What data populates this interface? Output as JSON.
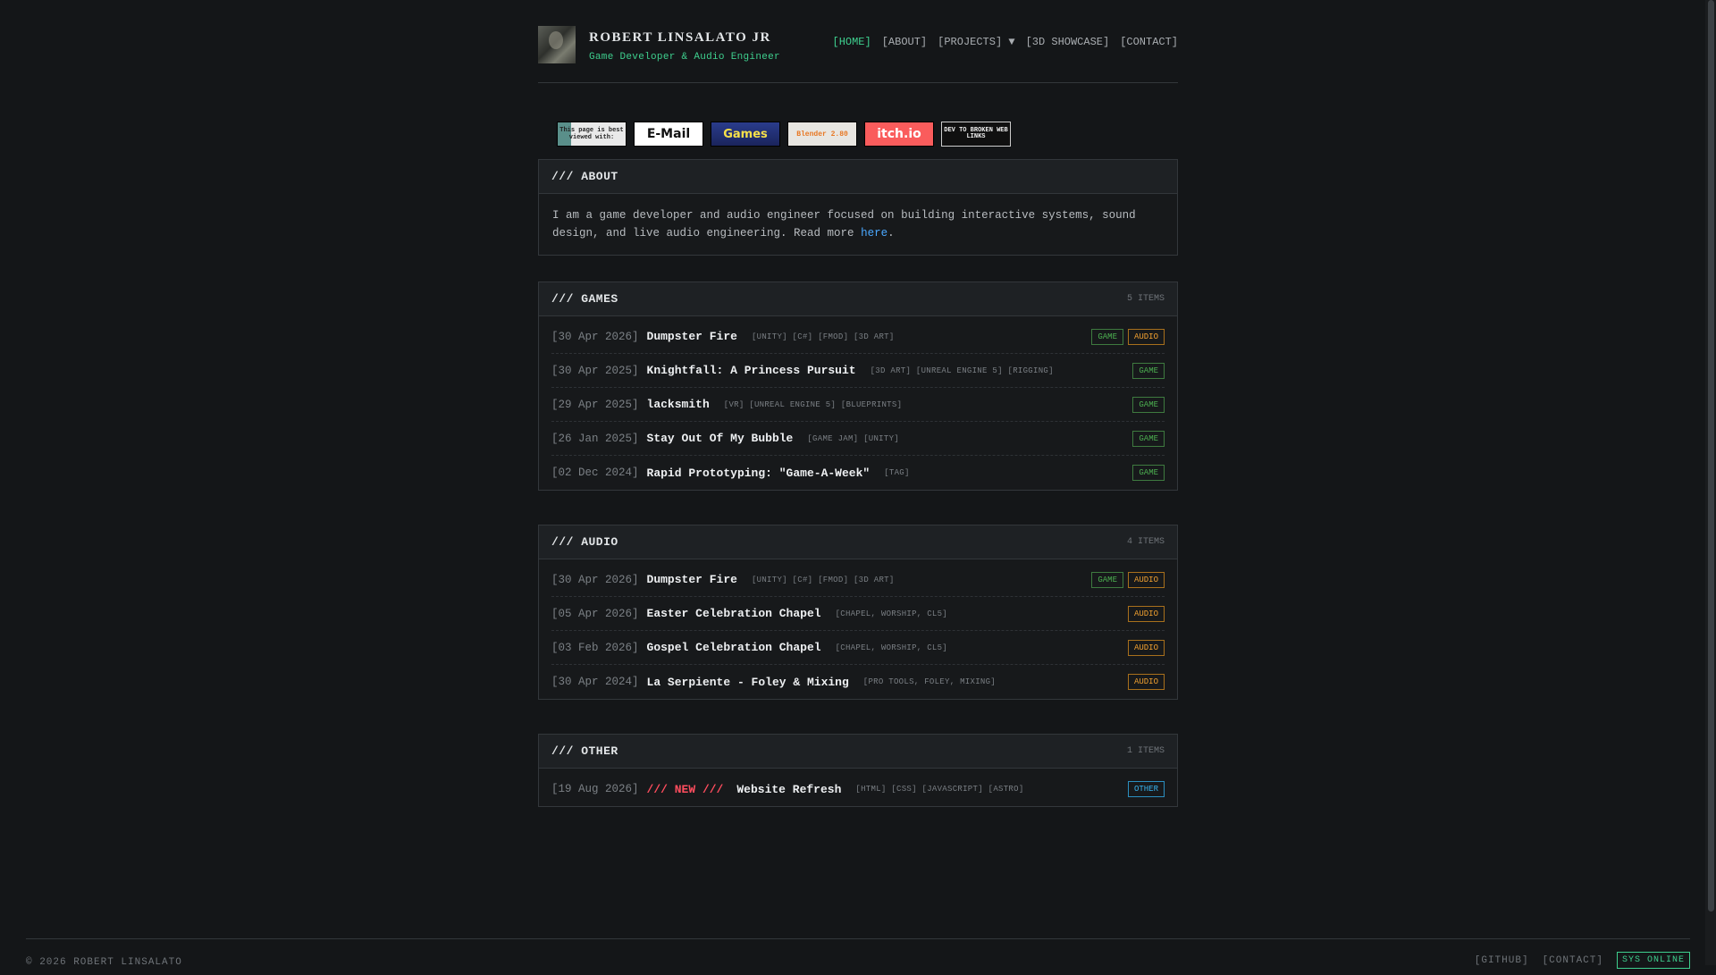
{
  "header": {
    "name": "ROBERT LINSALATO JR",
    "subtitle": "Game Developer & Audio Engineer",
    "nav": [
      "[HOME]",
      "[ABOUT]",
      "[PROJECTS] ▼",
      "[3D SHOWCASE]",
      "[CONTACT]"
    ]
  },
  "badges": [
    "This page is best viewed with:",
    "E-Mail",
    "Games",
    "Blender 2.80",
    "itch.io",
    "DEV TO BROKEN WEB LINKS"
  ],
  "about": {
    "title": "/// ABOUT",
    "text": "I am a game developer and audio engineer focused on building interactive systems, sound design, and live audio engineering. Read more ",
    "link": "here",
    "end": "."
  },
  "games": {
    "title": "/// GAMES",
    "count": "5 ITEMS",
    "rows": [
      {
        "date": "[30 Apr 2026]",
        "title": "Dumpster Fire",
        "tags": "[UNITY] [C#] [FMOD] [3D ART]",
        "labels": [
          "GAME",
          "AUDIO"
        ]
      },
      {
        "date": "[30 Apr 2025]",
        "title": "Knightfall: A Princess Pursuit",
        "tags": "[3D ART] [UNREAL ENGINE 5] [RIGGING]",
        "labels": [
          "GAME"
        ]
      },
      {
        "date": "[29 Apr 2025]",
        "title": "lacksmith",
        "tags": "[VR] [UNREAL ENGINE 5] [BLUEPRINTS]",
        "labels": [
          "GAME"
        ]
      },
      {
        "date": "[26 Jan 2025]",
        "title": "Stay Out Of My Bubble",
        "tags": "[GAME JAM] [UNITY]",
        "labels": [
          "GAME"
        ]
      },
      {
        "date": "[02 Dec 2024]",
        "title": "Rapid Prototyping: \"Game-A-Week\"",
        "tags": "[TAG]",
        "labels": [
          "GAME"
        ]
      }
    ]
  },
  "audio": {
    "title": "/// AUDIO",
    "count": "4 ITEMS",
    "rows": [
      {
        "date": "[30 Apr 2026]",
        "title": "Dumpster Fire",
        "tags": "[UNITY] [C#] [FMOD] [3D ART]",
        "labels": [
          "GAME",
          "AUDIO"
        ]
      },
      {
        "date": "[05 Apr 2026]",
        "title": "Easter Celebration Chapel",
        "tags": "[CHAPEL, WORSHIP, CL5]",
        "labels": [
          "AUDIO"
        ]
      },
      {
        "date": "[03 Feb 2026]",
        "title": "Gospel Celebration Chapel",
        "tags": "[CHAPEL, WORSHIP, CL5]",
        "labels": [
          "AUDIO"
        ]
      },
      {
        "date": "[30 Apr 2024]",
        "title": "La Serpiente - Foley & Mixing",
        "tags": "[PRO TOOLS, FOLEY, MIXING]",
        "labels": [
          "AUDIO"
        ]
      }
    ]
  },
  "other": {
    "title": "/// OTHER",
    "count": "1 ITEMS",
    "rows": [
      {
        "date": "[19 Aug 2026]",
        "new": "/// NEW ///",
        "title": "Website Refresh",
        "tags": "[HTML] [CSS] [JAVASCRIPT] [ASTRO]",
        "labels": [
          "OTHER"
        ]
      }
    ]
  },
  "footer": {
    "copyright": "© 2026 ROBERT LINSALATO",
    "links": [
      "[GITHUB]",
      "[CONTACT]"
    ],
    "status": "SYS ONLINE"
  },
  "colors": {
    "accent": "#3ecf8e",
    "game": "#4caf50",
    "audio": "#f0a030",
    "other": "#37b4f0",
    "new": "#ff4d5e",
    "link": "#4aa8ff"
  }
}
